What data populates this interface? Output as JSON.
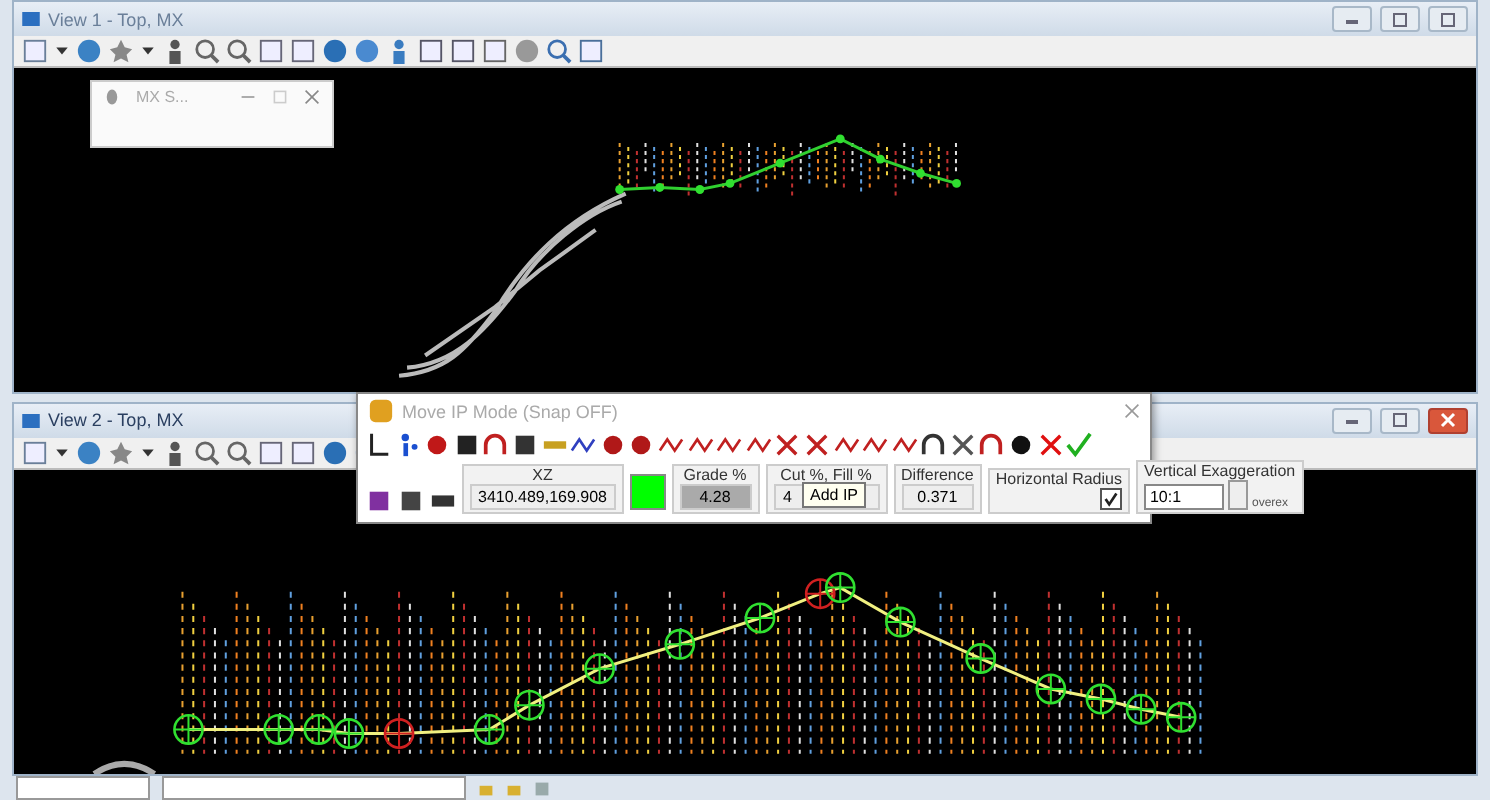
{
  "view1": {
    "title": "View 1 - Top, MX"
  },
  "floating_window": {
    "title": "MX S..."
  },
  "view2": {
    "title": "View 2 - Top, MX"
  },
  "dialog": {
    "title": "Move IP Mode (Snap OFF)",
    "xz": {
      "label": "XZ",
      "value": "3410.489,169.908"
    },
    "grade": {
      "label": "Grade %",
      "value": "4.28"
    },
    "cut_fill": {
      "label": "Cut %, Fill %",
      "value": "4"
    },
    "difference": {
      "label": "Difference",
      "value": "0.371"
    },
    "horizontal_radius": {
      "label": "Horizontal Radius",
      "checked": true
    },
    "vertical_exaggeration": {
      "label": "Vertical Exaggeration",
      "value": "10:1",
      "note": "overex"
    },
    "tooltip": "Add IP"
  }
}
